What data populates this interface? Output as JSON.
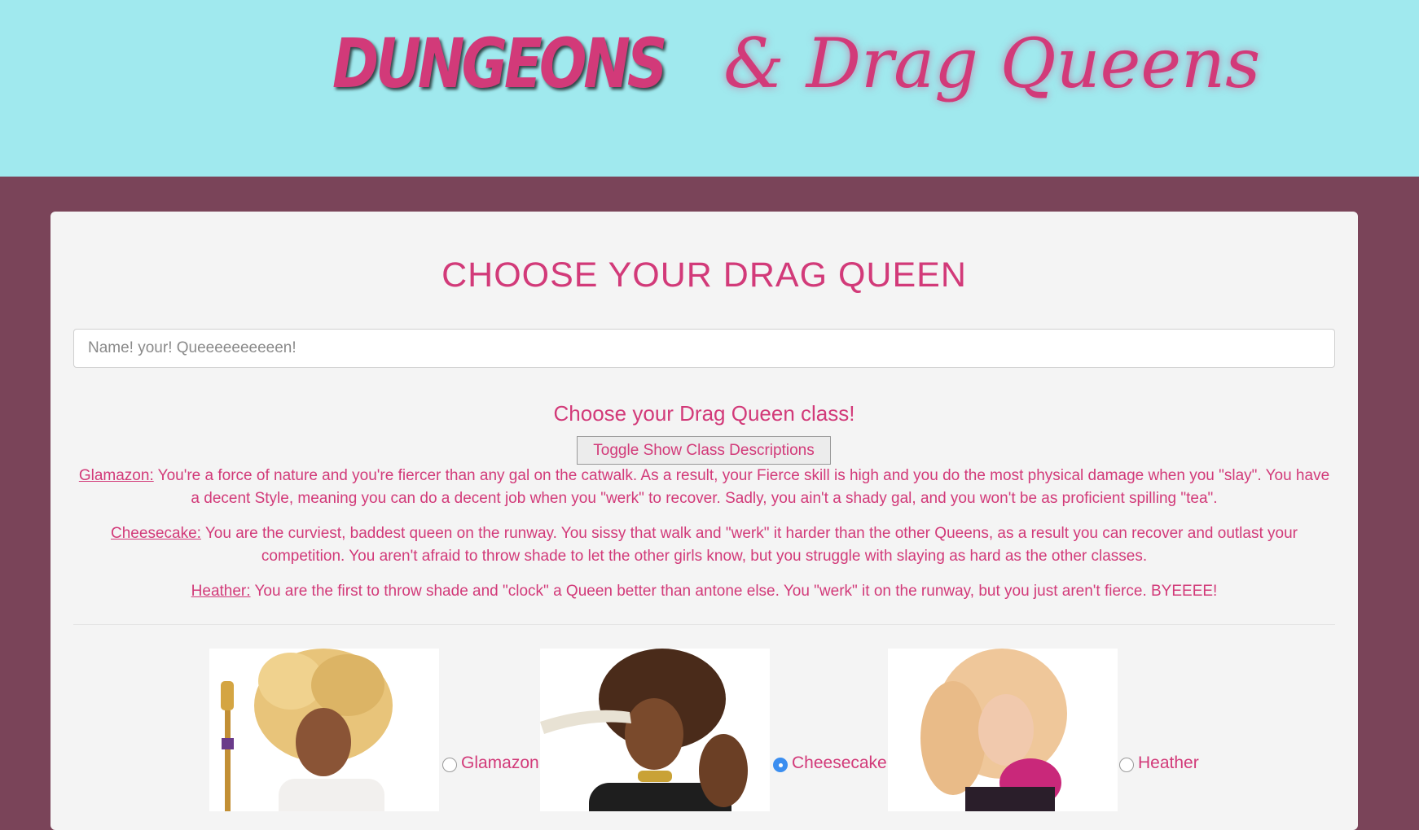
{
  "header": {
    "logo_bold": "DUNGEONS",
    "logo_script": "& Drag Queens"
  },
  "main": {
    "title": "CHOOSE YOUR DRAG QUEEN",
    "name_placeholder": "Name! your! Queeeeeeeeeen!",
    "class_prompt": "Choose your Drag Queen class!",
    "toggle_label": "Toggle Show Class Descriptions",
    "descriptions": [
      {
        "name": "Glamazon:",
        "text": " You're a force of nature and you're fiercer than any gal on the catwalk. As a result, your Fierce skill is high and you do the most physical damage when you \"slay\". You have a decent Style, meaning you can do a decent job when you \"werk\" to recover. Sadly, you ain't a shady gal, and you won't be as proficient spilling \"tea\"."
      },
      {
        "name": "Cheesecake:",
        "text": " You are the curviest, baddest queen on the runway. You sissy that walk and \"werk\" it harder than the other Queens, as a result you can recover and outlast your competition. You aren't afraid to throw shade to let the other girls know, but you struggle with slaying as hard as the other classes."
      },
      {
        "name": "Heather:",
        "text": " You are the first to throw shade and \"clock\" a Queen better than antone else. You \"werk\" it on the runway, but you just aren't fierce. BYEEEE!"
      }
    ],
    "options": [
      {
        "label": "Glamazon",
        "selected": false
      },
      {
        "label": "Cheesecake",
        "selected": true
      },
      {
        "label": "Heather",
        "selected": false
      }
    ]
  },
  "colors": {
    "header_bg": "#a0e9ee",
    "page_bg": "#7a4459",
    "accent_pink": "#d23a79",
    "panel_bg": "#f4f4f4",
    "radio_selected": "#3b8ef0"
  }
}
